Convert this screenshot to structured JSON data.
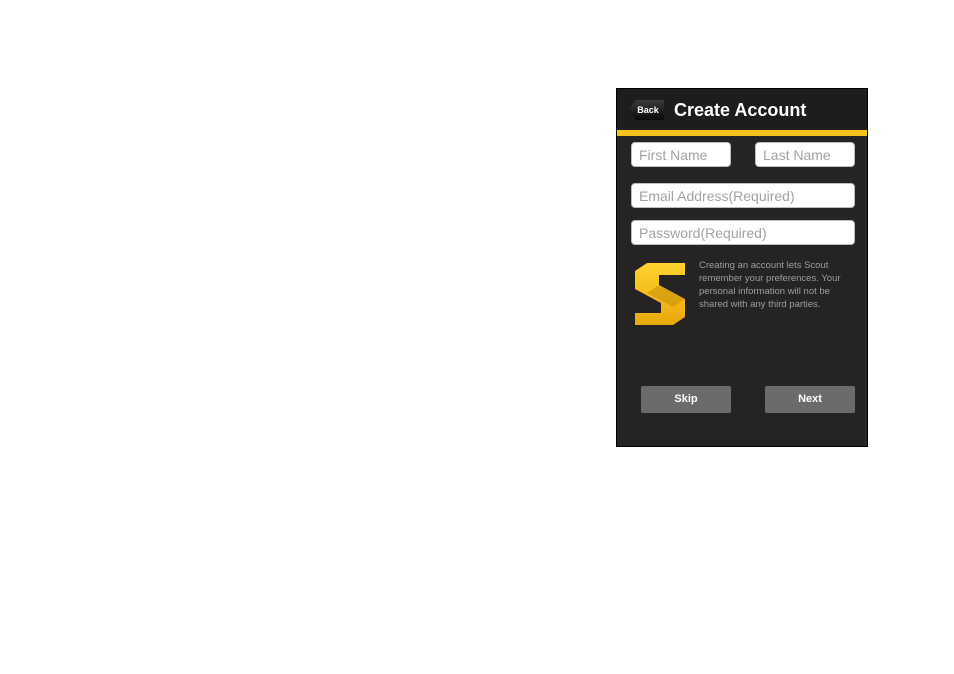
{
  "navbar": {
    "back_label": "Back",
    "title": "Create Account"
  },
  "form": {
    "first_name_placeholder": "First Name",
    "last_name_placeholder": "Last Name",
    "email_placeholder": "Email Address(Required)",
    "password_placeholder": "Password(Required)"
  },
  "info_text": "Creating an account lets Scout remember your preferences. Your personal information will not be shared with any third parties.",
  "buttons": {
    "skip_label": "Skip",
    "next_label": "Next"
  },
  "colors": {
    "accent": "#f4c21a",
    "background": "#252323",
    "button": "#6b6b6b"
  },
  "icons": {
    "logo": "scout-s-logo-icon"
  }
}
